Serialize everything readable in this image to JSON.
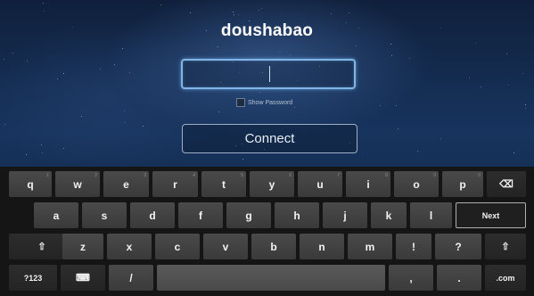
{
  "wifi_dialog": {
    "network_name": "doushabao",
    "password_value": "",
    "show_password_label": "Show Password",
    "show_password_checked": false,
    "connect_label": "Connect"
  },
  "keyboard": {
    "row1": [
      "q",
      "w",
      "e",
      "r",
      "t",
      "y",
      "u",
      "i",
      "o",
      "p"
    ],
    "row1_hints": [
      "1",
      "2",
      "3",
      "4",
      "5",
      "6",
      "7",
      "8",
      "9",
      "0"
    ],
    "row2": [
      "a",
      "s",
      "d",
      "f",
      "g",
      "h",
      "j",
      "k",
      "l"
    ],
    "row3": [
      "z",
      "x",
      "c",
      "v",
      "b",
      "n",
      "m",
      "!",
      "?"
    ],
    "backspace_icon": "⌫",
    "shift_icon": "⇧",
    "next_label": "Next",
    "symbols_label": "?123",
    "voice_icon": "⌨",
    "slash_key": "/",
    "comma_key": ",",
    "period_key": ".",
    "dotcom_label": ".com",
    "icons": {
      "backspace": "backspace-icon",
      "shift": "shift-icon",
      "voice": "keyboard-settings-icon"
    }
  }
}
